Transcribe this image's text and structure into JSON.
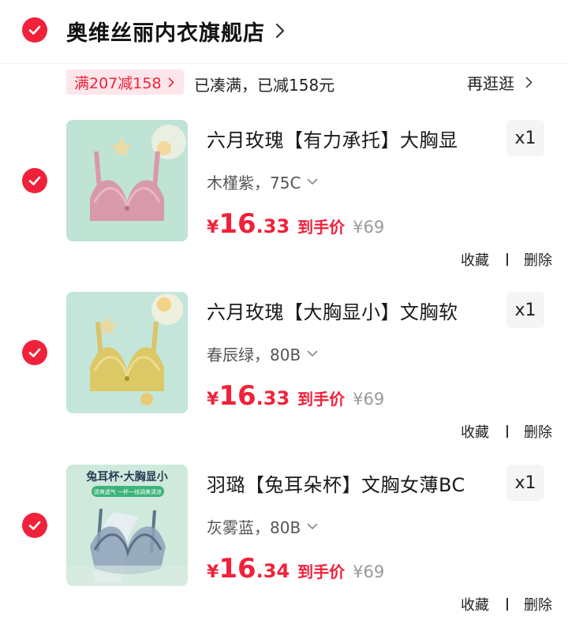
{
  "store": {
    "name": "奥维丝丽内衣旗舰店"
  },
  "promo": {
    "tag": "满207减158",
    "status": "已凑满，已减158元",
    "link": "再逛逛"
  },
  "items": [
    {
      "title": "六月玫瑰【有力承托】大胸显",
      "qty": "x1",
      "sku": "木槿紫，75C",
      "price_symbol": "¥",
      "price_int": "16",
      "price_dec": ".33",
      "price_label": "到手价",
      "orig_price": "¥69",
      "collect": "收藏",
      "delete": "删除"
    },
    {
      "title": "六月玫瑰【大胸显小】文胸软",
      "qty": "x1",
      "sku": "春辰绿，80B",
      "price_symbol": "¥",
      "price_int": "16",
      "price_dec": ".33",
      "price_label": "到手价",
      "orig_price": "¥69",
      "collect": "收藏",
      "delete": "删除"
    },
    {
      "title": "羽璐【兔耳朵杯】文胸女薄BC",
      "qty": "x1",
      "sku": "灰雾蓝，80B",
      "price_symbol": "¥",
      "price_int": "16",
      "price_dec": ".34",
      "price_label": "到手价",
      "orig_price": "¥69",
      "collect": "收藏",
      "delete": "删除",
      "image_banner": "兔耳杯·大胸显小",
      "image_subbanner": "清爽透气 一杯一线调美清凉"
    }
  ],
  "colors": {
    "accent": "#f0223b",
    "promo_bg": "#fde6ea",
    "qty_bg": "#f5f5f5"
  },
  "icons": {
    "check": "checkmark-circle-icon",
    "chevron_right": "chevron-right-icon",
    "chevron_down": "chevron-down-icon"
  }
}
